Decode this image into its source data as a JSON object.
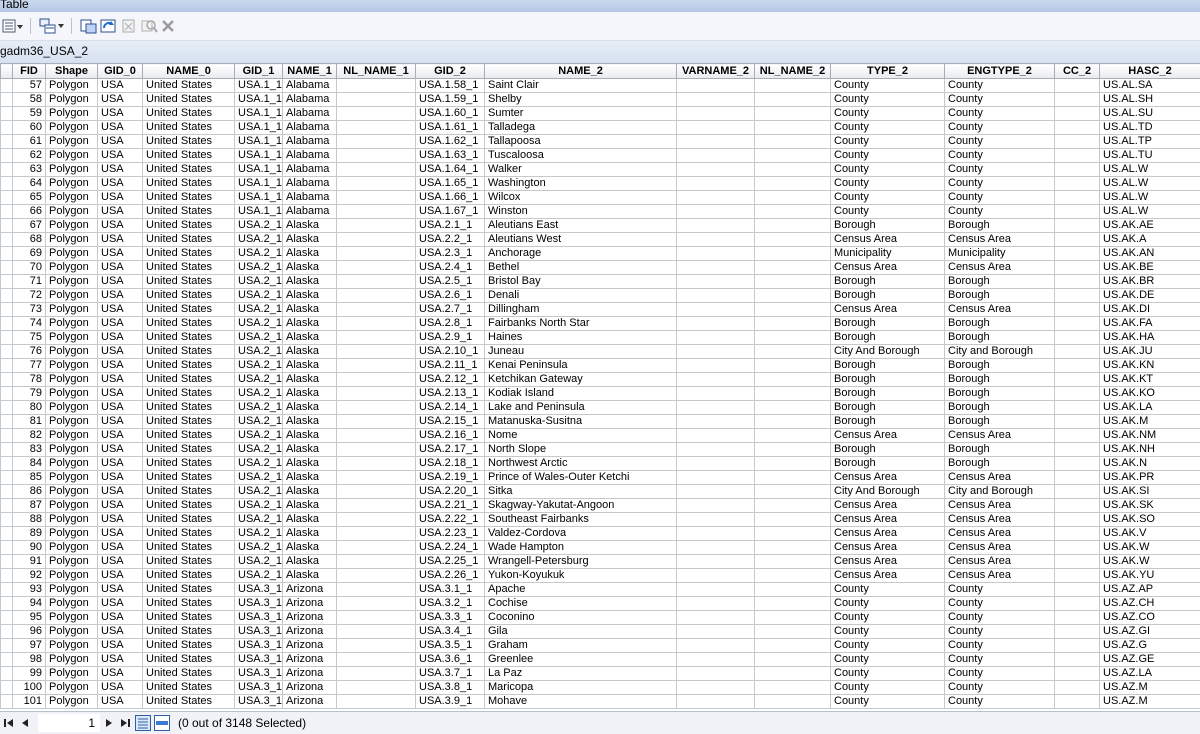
{
  "window": {
    "title": "Table"
  },
  "tab": {
    "label": "gadm36_USA_2"
  },
  "status": {
    "record": "1",
    "selection": "(0 out of 3148 Selected)"
  },
  "columns": [
    "FID",
    "Shape",
    "GID_0",
    "NAME_0",
    "GID_1",
    "NAME_1",
    "NL_NAME_1",
    "GID_2",
    "NAME_2",
    "VARNAME_2",
    "NL_NAME_2",
    "TYPE_2",
    "ENGTYPE_2",
    "CC_2",
    "HASC_2"
  ],
  "rows": [
    [
      "57",
      "Polygon",
      "USA",
      "United States",
      "USA.1_1",
      "Alabama",
      "",
      "USA.1.58_1",
      "Saint Clair",
      "",
      "",
      "County",
      "County",
      "",
      "US.AL.SA"
    ],
    [
      "58",
      "Polygon",
      "USA",
      "United States",
      "USA.1_1",
      "Alabama",
      "",
      "USA.1.59_1",
      "Shelby",
      "",
      "",
      "County",
      "County",
      "",
      "US.AL.SH"
    ],
    [
      "59",
      "Polygon",
      "USA",
      "United States",
      "USA.1_1",
      "Alabama",
      "",
      "USA.1.60_1",
      "Sumter",
      "",
      "",
      "County",
      "County",
      "",
      "US.AL.SU"
    ],
    [
      "60",
      "Polygon",
      "USA",
      "United States",
      "USA.1_1",
      "Alabama",
      "",
      "USA.1.61_1",
      "Talladega",
      "",
      "",
      "County",
      "County",
      "",
      "US.AL.TD"
    ],
    [
      "61",
      "Polygon",
      "USA",
      "United States",
      "USA.1_1",
      "Alabama",
      "",
      "USA.1.62_1",
      "Tallapoosa",
      "",
      "",
      "County",
      "County",
      "",
      "US.AL.TP"
    ],
    [
      "62",
      "Polygon",
      "USA",
      "United States",
      "USA.1_1",
      "Alabama",
      "",
      "USA.1.63_1",
      "Tuscaloosa",
      "",
      "",
      "County",
      "County",
      "",
      "US.AL.TU"
    ],
    [
      "63",
      "Polygon",
      "USA",
      "United States",
      "USA.1_1",
      "Alabama",
      "",
      "USA.1.64_1",
      "Walker",
      "",
      "",
      "County",
      "County",
      "",
      "US.AL.W"
    ],
    [
      "64",
      "Polygon",
      "USA",
      "United States",
      "USA.1_1",
      "Alabama",
      "",
      "USA.1.65_1",
      "Washington",
      "",
      "",
      "County",
      "County",
      "",
      "US.AL.W"
    ],
    [
      "65",
      "Polygon",
      "USA",
      "United States",
      "USA.1_1",
      "Alabama",
      "",
      "USA.1.66_1",
      "Wilcox",
      "",
      "",
      "County",
      "County",
      "",
      "US.AL.W"
    ],
    [
      "66",
      "Polygon",
      "USA",
      "United States",
      "USA.1_1",
      "Alabama",
      "",
      "USA.1.67_1",
      "Winston",
      "",
      "",
      "County",
      "County",
      "",
      "US.AL.W"
    ],
    [
      "67",
      "Polygon",
      "USA",
      "United States",
      "USA.2_1",
      "Alaska",
      "",
      "USA.2.1_1",
      "Aleutians East",
      "",
      "",
      "Borough",
      "Borough",
      "",
      "US.AK.AE"
    ],
    [
      "68",
      "Polygon",
      "USA",
      "United States",
      "USA.2_1",
      "Alaska",
      "",
      "USA.2.2_1",
      "Aleutians West",
      "",
      "",
      "Census Area",
      "Census Area",
      "",
      "US.AK.A"
    ],
    [
      "69",
      "Polygon",
      "USA",
      "United States",
      "USA.2_1",
      "Alaska",
      "",
      "USA.2.3_1",
      "Anchorage",
      "",
      "",
      "Municipality",
      "Municipality",
      "",
      "US.AK.AN"
    ],
    [
      "70",
      "Polygon",
      "USA",
      "United States",
      "USA.2_1",
      "Alaska",
      "",
      "USA.2.4_1",
      "Bethel",
      "",
      "",
      "Census Area",
      "Census Area",
      "",
      "US.AK.BE"
    ],
    [
      "71",
      "Polygon",
      "USA",
      "United States",
      "USA.2_1",
      "Alaska",
      "",
      "USA.2.5_1",
      "Bristol Bay",
      "",
      "",
      "Borough",
      "Borough",
      "",
      "US.AK.BR"
    ],
    [
      "72",
      "Polygon",
      "USA",
      "United States",
      "USA.2_1",
      "Alaska",
      "",
      "USA.2.6_1",
      "Denali",
      "",
      "",
      "Borough",
      "Borough",
      "",
      "US.AK.DE"
    ],
    [
      "73",
      "Polygon",
      "USA",
      "United States",
      "USA.2_1",
      "Alaska",
      "",
      "USA.2.7_1",
      "Dillingham",
      "",
      "",
      "Census Area",
      "Census Area",
      "",
      "US.AK.DI"
    ],
    [
      "74",
      "Polygon",
      "USA",
      "United States",
      "USA.2_1",
      "Alaska",
      "",
      "USA.2.8_1",
      "Fairbanks North Star",
      "",
      "",
      "Borough",
      "Borough",
      "",
      "US.AK.FA"
    ],
    [
      "75",
      "Polygon",
      "USA",
      "United States",
      "USA.2_1",
      "Alaska",
      "",
      "USA.2.9_1",
      "Haines",
      "",
      "",
      "Borough",
      "Borough",
      "",
      "US.AK.HA"
    ],
    [
      "76",
      "Polygon",
      "USA",
      "United States",
      "USA.2_1",
      "Alaska",
      "",
      "USA.2.10_1",
      "Juneau",
      "",
      "",
      "City And Borough",
      "City and Borough",
      "",
      "US.AK.JU"
    ],
    [
      "77",
      "Polygon",
      "USA",
      "United States",
      "USA.2_1",
      "Alaska",
      "",
      "USA.2.11_1",
      "Kenai Peninsula",
      "",
      "",
      "Borough",
      "Borough",
      "",
      "US.AK.KN"
    ],
    [
      "78",
      "Polygon",
      "USA",
      "United States",
      "USA.2_1",
      "Alaska",
      "",
      "USA.2.12_1",
      "Ketchikan Gateway",
      "",
      "",
      "Borough",
      "Borough",
      "",
      "US.AK.KT"
    ],
    [
      "79",
      "Polygon",
      "USA",
      "United States",
      "USA.2_1",
      "Alaska",
      "",
      "USA.2.13_1",
      "Kodiak Island",
      "",
      "",
      "Borough",
      "Borough",
      "",
      "US.AK.KO"
    ],
    [
      "80",
      "Polygon",
      "USA",
      "United States",
      "USA.2_1",
      "Alaska",
      "",
      "USA.2.14_1",
      "Lake and Peninsula",
      "",
      "",
      "Borough",
      "Borough",
      "",
      "US.AK.LA"
    ],
    [
      "81",
      "Polygon",
      "USA",
      "United States",
      "USA.2_1",
      "Alaska",
      "",
      "USA.2.15_1",
      "Matanuska-Susitna",
      "",
      "",
      "Borough",
      "Borough",
      "",
      "US.AK.M"
    ],
    [
      "82",
      "Polygon",
      "USA",
      "United States",
      "USA.2_1",
      "Alaska",
      "",
      "USA.2.16_1",
      "Nome",
      "",
      "",
      "Census Area",
      "Census Area",
      "",
      "US.AK.NM"
    ],
    [
      "83",
      "Polygon",
      "USA",
      "United States",
      "USA.2_1",
      "Alaska",
      "",
      "USA.2.17_1",
      "North Slope",
      "",
      "",
      "Borough",
      "Borough",
      "",
      "US.AK.NH"
    ],
    [
      "84",
      "Polygon",
      "USA",
      "United States",
      "USA.2_1",
      "Alaska",
      "",
      "USA.2.18_1",
      "Northwest Arctic",
      "",
      "",
      "Borough",
      "Borough",
      "",
      "US.AK.N"
    ],
    [
      "85",
      "Polygon",
      "USA",
      "United States",
      "USA.2_1",
      "Alaska",
      "",
      "USA.2.19_1",
      "Prince of Wales-Outer Ketchi",
      "",
      "",
      "Census Area",
      "Census Area",
      "",
      "US.AK.PR"
    ],
    [
      "86",
      "Polygon",
      "USA",
      "United States",
      "USA.2_1",
      "Alaska",
      "",
      "USA.2.20_1",
      "Sitka",
      "",
      "",
      "City And Borough",
      "City and Borough",
      "",
      "US.AK.SI"
    ],
    [
      "87",
      "Polygon",
      "USA",
      "United States",
      "USA.2_1",
      "Alaska",
      "",
      "USA.2.21_1",
      "Skagway-Yakutat-Angoon",
      "",
      "",
      "Census Area",
      "Census Area",
      "",
      "US.AK.SK"
    ],
    [
      "88",
      "Polygon",
      "USA",
      "United States",
      "USA.2_1",
      "Alaska",
      "",
      "USA.2.22_1",
      "Southeast Fairbanks",
      "",
      "",
      "Census Area",
      "Census Area",
      "",
      "US.AK.SO"
    ],
    [
      "89",
      "Polygon",
      "USA",
      "United States",
      "USA.2_1",
      "Alaska",
      "",
      "USA.2.23_1",
      "Valdez-Cordova",
      "",
      "",
      "Census Area",
      "Census Area",
      "",
      "US.AK.V"
    ],
    [
      "90",
      "Polygon",
      "USA",
      "United States",
      "USA.2_1",
      "Alaska",
      "",
      "USA.2.24_1",
      "Wade Hampton",
      "",
      "",
      "Census Area",
      "Census Area",
      "",
      "US.AK.W"
    ],
    [
      "91",
      "Polygon",
      "USA",
      "United States",
      "USA.2_1",
      "Alaska",
      "",
      "USA.2.25_1",
      "Wrangell-Petersburg",
      "",
      "",
      "Census Area",
      "Census Area",
      "",
      "US.AK.W"
    ],
    [
      "92",
      "Polygon",
      "USA",
      "United States",
      "USA.2_1",
      "Alaska",
      "",
      "USA.2.26_1",
      "Yukon-Koyukuk",
      "",
      "",
      "Census Area",
      "Census Area",
      "",
      "US.AK.YU"
    ],
    [
      "93",
      "Polygon",
      "USA",
      "United States",
      "USA.3_1",
      "Arizona",
      "",
      "USA.3.1_1",
      "Apache",
      "",
      "",
      "County",
      "County",
      "",
      "US.AZ.AP"
    ],
    [
      "94",
      "Polygon",
      "USA",
      "United States",
      "USA.3_1",
      "Arizona",
      "",
      "USA.3.2_1",
      "Cochise",
      "",
      "",
      "County",
      "County",
      "",
      "US.AZ.CH"
    ],
    [
      "95",
      "Polygon",
      "USA",
      "United States",
      "USA.3_1",
      "Arizona",
      "",
      "USA.3.3_1",
      "Coconino",
      "",
      "",
      "County",
      "County",
      "",
      "US.AZ.CO"
    ],
    [
      "96",
      "Polygon",
      "USA",
      "United States",
      "USA.3_1",
      "Arizona",
      "",
      "USA.3.4_1",
      "Gila",
      "",
      "",
      "County",
      "County",
      "",
      "US.AZ.GI"
    ],
    [
      "97",
      "Polygon",
      "USA",
      "United States",
      "USA.3_1",
      "Arizona",
      "",
      "USA.3.5_1",
      "Graham",
      "",
      "",
      "County",
      "County",
      "",
      "US.AZ.G"
    ],
    [
      "98",
      "Polygon",
      "USA",
      "United States",
      "USA.3_1",
      "Arizona",
      "",
      "USA.3.6_1",
      "Greenlee",
      "",
      "",
      "County",
      "County",
      "",
      "US.AZ.GE"
    ],
    [
      "99",
      "Polygon",
      "USA",
      "United States",
      "USA.3_1",
      "Arizona",
      "",
      "USA.3.7_1",
      "La Paz",
      "",
      "",
      "County",
      "County",
      "",
      "US.AZ.LA"
    ],
    [
      "100",
      "Polygon",
      "USA",
      "United States",
      "USA.3_1",
      "Arizona",
      "",
      "USA.3.8_1",
      "Maricopa",
      "",
      "",
      "County",
      "County",
      "",
      "US.AZ.M"
    ],
    [
      "101",
      "Polygon",
      "USA",
      "United States",
      "USA.3_1",
      "Arizona",
      "",
      "USA.3.9_1",
      "Mohave",
      "",
      "",
      "County",
      "County",
      "",
      "US.AZ.M"
    ]
  ]
}
